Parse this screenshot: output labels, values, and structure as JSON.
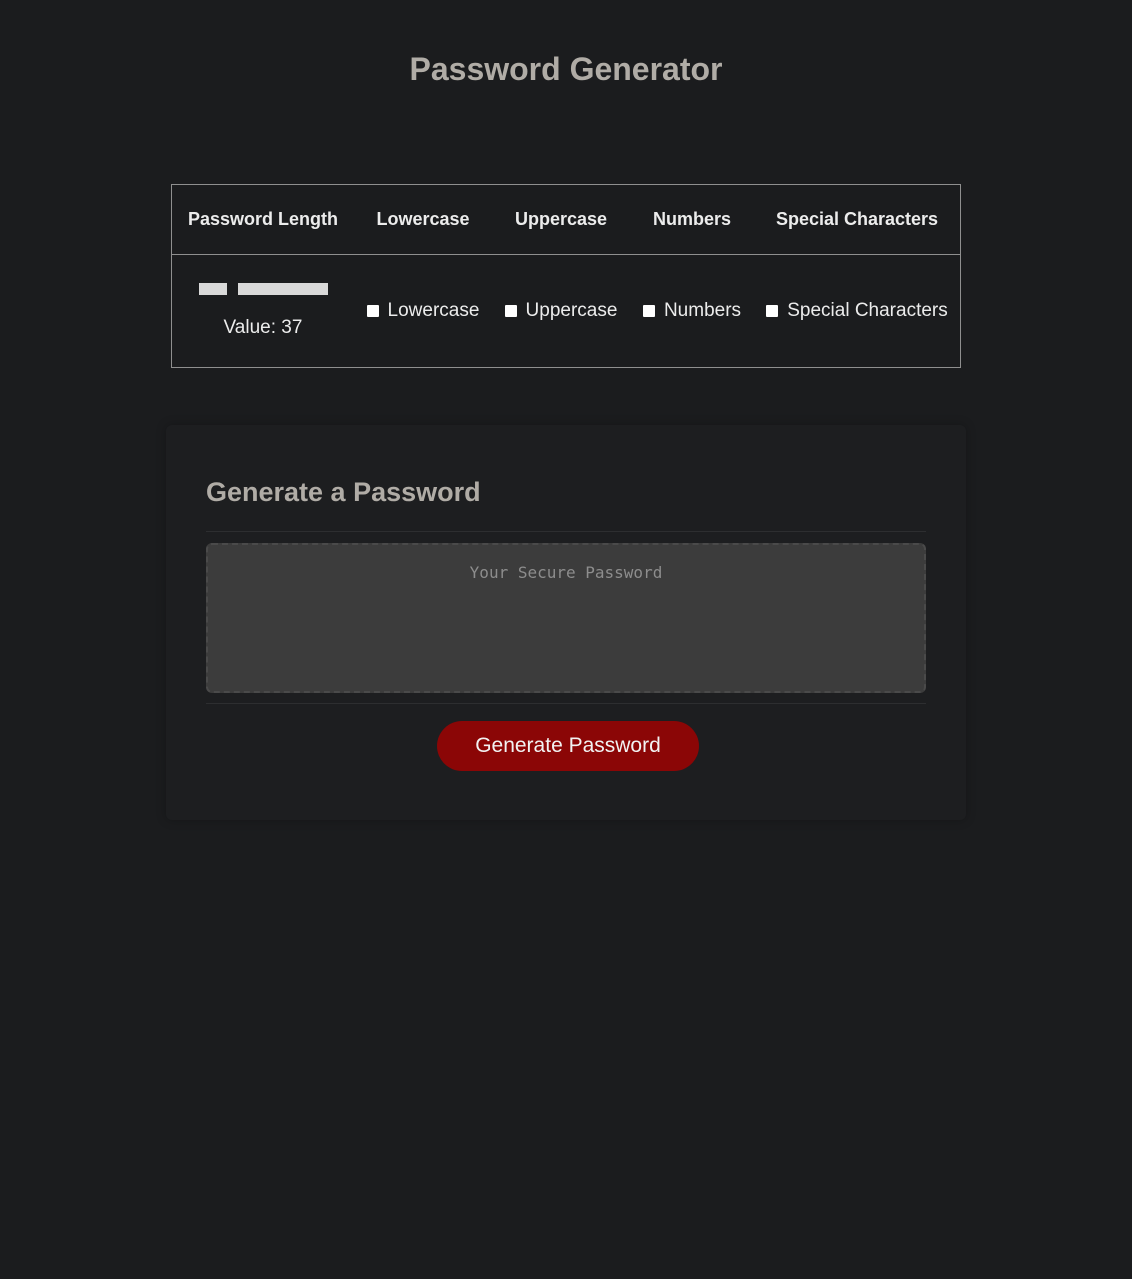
{
  "header": {
    "title": "Password Generator"
  },
  "options": {
    "columns": {
      "length": "Password Length",
      "lowercase": "Lowercase",
      "uppercase": "Uppercase",
      "numbers": "Numbers",
      "special": "Special Characters"
    },
    "length": {
      "value_text": "Value: 37",
      "value": 37
    },
    "checkboxes": {
      "lowercase": {
        "label": "Lowercase",
        "checked": false
      },
      "uppercase": {
        "label": "Uppercase",
        "checked": false
      },
      "numbers": {
        "label": "Numbers",
        "checked": false
      },
      "special": {
        "label": "Special Characters",
        "checked": false
      }
    }
  },
  "card": {
    "title": "Generate a Password",
    "password_placeholder": "Your Secure Password",
    "password_value": "",
    "button_label": "Generate Password"
  },
  "colors": {
    "background": "#1b1c1e",
    "heading": "#b0aca6",
    "button": "#8b0606",
    "password_box": "#3c3c3c"
  }
}
